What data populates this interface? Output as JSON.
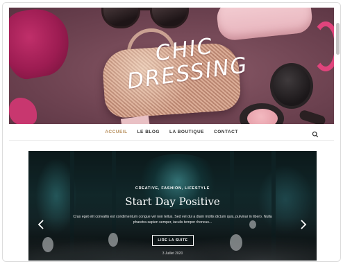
{
  "hero": {
    "title_line1": "CHIC",
    "title_line2": "DRESSING"
  },
  "nav": {
    "items": [
      {
        "label": "ACCUEIL",
        "active": true
      },
      {
        "label": "LE BLOG",
        "active": false
      },
      {
        "label": "LA BOUTIQUE",
        "active": false
      },
      {
        "label": "CONTACT",
        "active": false
      }
    ],
    "search_icon": "search-icon"
  },
  "slider": {
    "categories": "CREATIVE, FASHION, LIFESTYLE",
    "title": "Start Day Positive",
    "excerpt": "Cras eget elit convallis est condimentum congue vel non tellus. Sed vel dui a diam mollis dictum quis, pulvinar in libero. Nulla pharetra sapien semper, iaculis tempor rhoncus...",
    "button_label": "LIRE LA SUITE",
    "date": "3 Juillet 2020",
    "prev_icon": "chevron-left-icon",
    "next_icon": "chevron-right-icon"
  },
  "colors": {
    "accent": "#b8905e",
    "nav_text": "#333333",
    "hero_bg": "#6f4452"
  }
}
